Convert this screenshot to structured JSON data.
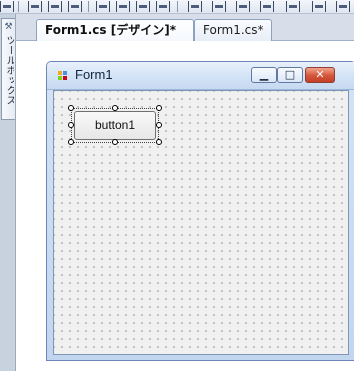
{
  "toolbox": {
    "icon_name": "toolbox-icon",
    "label": "ツールボックス"
  },
  "tabs": [
    {
      "label": "Form1.cs [デザイン]*",
      "active": true
    },
    {
      "label": "Form1.cs*",
      "active": false
    }
  ],
  "form": {
    "title": "Form1",
    "button_label": "button1",
    "window_buttons": {
      "minimize_icon": "minimize-icon",
      "maximize_icon": "maximize-icon",
      "close_icon": "close-icon"
    }
  },
  "colors": {
    "accent": "#d3553a",
    "designer_dots": "#3a3a3a"
  }
}
